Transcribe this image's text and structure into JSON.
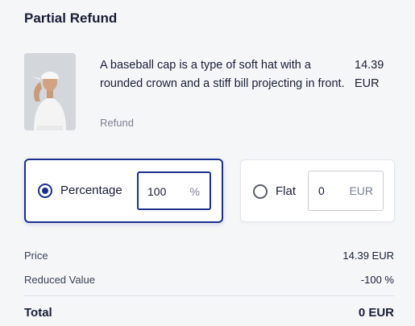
{
  "header": {
    "title": "Partial Refund"
  },
  "product": {
    "description": "A baseball cap is a type of soft hat with a rounded crown and a stiff bill projecting in front.",
    "status": "Refund",
    "price_amount": "14.39",
    "price_currency": "EUR"
  },
  "options": {
    "percentage": {
      "label": "Percentage",
      "value": "100",
      "unit": "%",
      "selected": true
    },
    "flat": {
      "label": "Flat",
      "value": "0",
      "unit": "EUR",
      "selected": false
    }
  },
  "summary": {
    "price_label": "Price",
    "price_value": "14.39 EUR",
    "reduced_label": "Reduced Value",
    "reduced_value": "-100 %",
    "total_label": "Total",
    "total_value": "0 EUR"
  },
  "colors": {
    "accent": "#1c2f8c",
    "text": "#1a1f36",
    "muted": "#7b8194"
  }
}
